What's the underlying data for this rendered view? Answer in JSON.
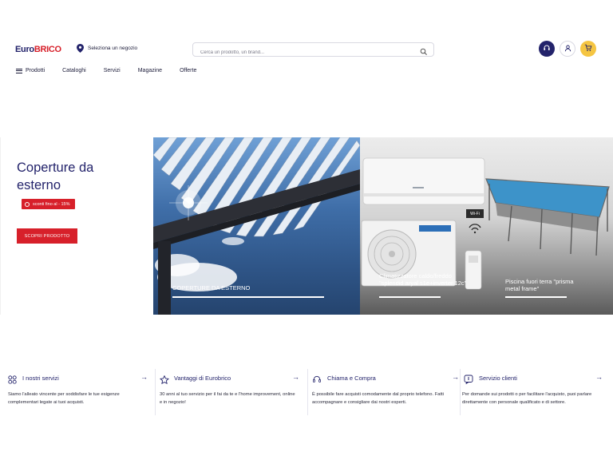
{
  "header": {
    "logo_part1": "Euro",
    "logo_part2": "BRICO",
    "store_selector": "Seleziona un negozio",
    "search_placeholder": "Cerca un prodotto, un brand..."
  },
  "nav": {
    "items": [
      "Prodotti",
      "Cataloghi",
      "Servizi",
      "Magazine",
      "Offerte"
    ]
  },
  "hero": {
    "title": "Coperture da esterno",
    "discount": "sconti fino al - 15%",
    "cta": "SCOPRI PRODOTTO",
    "panels": [
      {
        "caption": "COPERTURE DA ESTERNO"
      },
      {
        "caption": "Climatizzatore caldo/freddo \"splendid aryal s1e+inverter 12c\""
      },
      {
        "caption": "Piscina fuori terra \"prisma metal frame\""
      }
    ],
    "wifi_label": "Wi-Fi"
  },
  "services": [
    {
      "title": "I nostri servizi",
      "desc": "Siamo l'alleato vincente per soddisfare le tue esigenze complementari legate ai tuoi acquisti."
    },
    {
      "title": "Vantaggi di Eurobrico",
      "desc": "30 anni al tuo servizio per il fai da te e l'home improvement, online e in negozio!"
    },
    {
      "title": "Chiama e Compra",
      "desc": "È possibile fare acquisti comodamente dal proprio telefono. Fatti accompagnare e consigliare dai nostri esperti."
    },
    {
      "title": "Servizio clienti",
      "desc": "Per domande sui prodotti o per facilitare l'acquisto, puoi parlare direttamente con personale qualificato e di settore."
    }
  ],
  "colors": {
    "brand_blue": "#23236b",
    "brand_red": "#d7202a",
    "cart_yellow": "#f5c542"
  }
}
